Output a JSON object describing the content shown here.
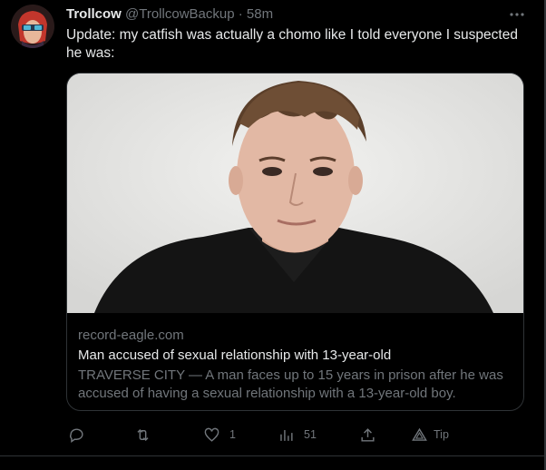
{
  "tweet": {
    "display_name": "Trollcow",
    "handle": "@TrollcowBackup",
    "separator": "·",
    "time": "58m",
    "text": "Update: my catfish was actually a chomo like I told everyone I suspected he was:",
    "more_icon": "more-dots-icon"
  },
  "card": {
    "domain": "record-eagle.com",
    "headline": "Man accused of sexual relationship with 13-year-old",
    "description": "TRAVERSE CITY — A man faces up to 15 years in prison after he was accused of having a sexual relationship with a 13-year-old boy."
  },
  "actions": {
    "reply": {
      "icon": "reply-icon",
      "count": ""
    },
    "retweet": {
      "icon": "retweet-icon",
      "count": ""
    },
    "like": {
      "icon": "heart-icon",
      "count": "1"
    },
    "views": {
      "icon": "views-icon",
      "count": "51"
    },
    "share": {
      "icon": "share-icon"
    },
    "tip": {
      "icon": "tip-icon",
      "label": "Tip"
    }
  },
  "colors": {
    "background": "#000000",
    "text_primary": "#e7e9ea",
    "text_secondary": "#71767b",
    "border": "#2f3336"
  }
}
